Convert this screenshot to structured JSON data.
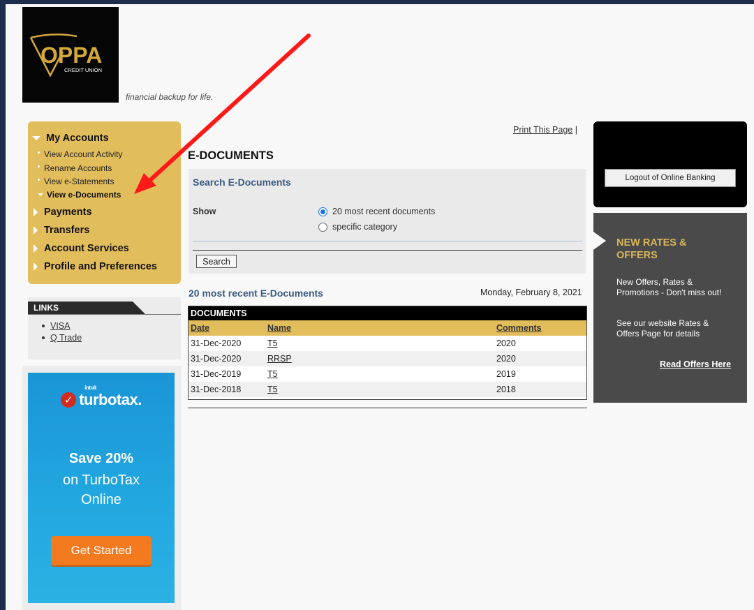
{
  "header": {
    "logo_text": "OPPA",
    "logo_subtext": "CREDIT UNION",
    "tagline": "financial backup for life."
  },
  "nav": {
    "my_accounts": "My Accounts",
    "sub_items": [
      "View Account Activity",
      "Rename Accounts",
      "View e-Statements",
      "View e-Documents"
    ],
    "payments": "Payments",
    "transfers": "Transfers",
    "account_services": "Account Services",
    "profile": "Profile and Preferences"
  },
  "links": {
    "heading": "LINKS",
    "items": [
      "VISA",
      "Q Trade"
    ]
  },
  "ad": {
    "brand_small": "intuit",
    "brand": "turbotax.",
    "headline": "Save 20%",
    "line1": "on TurboTax",
    "line2": "Online",
    "button": "Get Started"
  },
  "main": {
    "print_link": "Print This Page",
    "print_sep": "|",
    "title": "E-DOCUMENTS",
    "search": {
      "title": "Search E-Documents",
      "show_label": "Show",
      "options": [
        "20 most recent documents",
        "specific category"
      ],
      "selected": "20 most recent documents",
      "button": "Search"
    },
    "recent_title": "20 most recent E-Documents",
    "date": "Monday, February 8, 2021",
    "table": {
      "heading": "DOCUMENTS",
      "columns": [
        "Date",
        "Name",
        "Comments"
      ],
      "rows": [
        {
          "date": "31-Dec-2020",
          "name": "T5",
          "comments": "2020"
        },
        {
          "date": "31-Dec-2020",
          "name": "RRSP",
          "comments": "2020"
        },
        {
          "date": "31-Dec-2019",
          "name": "T5",
          "comments": "2019"
        },
        {
          "date": "31-Dec-2018",
          "name": "T5",
          "comments": "2018"
        }
      ]
    }
  },
  "right": {
    "logout": "Logout of Online Banking",
    "rates_title": "NEW RATES & OFFERS",
    "rates_p1": "New Offers, Rates & Promotions - Don't miss out!",
    "rates_p2": "See our website Rates & Offers Page for details",
    "rates_link": "Read Offers Here"
  },
  "colors": {
    "nav_gold": "#e2bd5c",
    "link_blue": "#3a5b82",
    "annotation_arrow": "#ff0000",
    "rates_gold": "#d9b45a"
  }
}
